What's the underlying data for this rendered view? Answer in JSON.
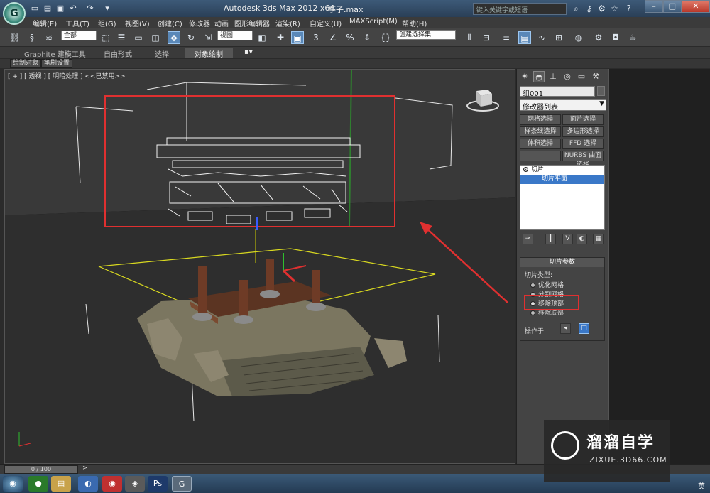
{
  "titlebar": {
    "app_title": "Autodesk 3ds Max  2012 x64",
    "file_title": "亭子.max",
    "search_placeholder": "键入关键字或短语",
    "help_label": "?",
    "logo": "3ds-max-logo"
  },
  "menubar": [
    "编辑(E)",
    "工具(T)",
    "组(G)",
    "视图(V)",
    "创建(C)",
    "修改器",
    "动画",
    "图形编辑器",
    "渲染(R)",
    "自定义(U)",
    "MAXScript(M)",
    "帮助(H)"
  ],
  "toolbar": {
    "filter_value": "全部",
    "refcoord_value": "视图",
    "numeric_a": "3",
    "numeric_b": "%",
    "selset_value": "创建选择集"
  },
  "ribbon": {
    "tabs": [
      "Graphite 建模工具",
      "自由形式",
      "选择",
      "对象绘制"
    ],
    "subtabs": [
      "绘制对象",
      "笔刷设置"
    ]
  },
  "viewport": {
    "label": "[ + ] [ 透视 ] [ 明暗处理 ] <<已禁用>>",
    "annotation_color": "#e03030"
  },
  "cmdpanel": {
    "object_name": "组001",
    "modifier_list": "修改器列表",
    "buttons": [
      "网格选择",
      "面片选择",
      "样条线选择",
      "多边形选择",
      "体积选择",
      "FFD 选择",
      "",
      "NURBS 曲面选择"
    ],
    "stack": [
      "切片",
      "切片平面"
    ],
    "rollout": {
      "title": "切片参数",
      "type_label": "切片类型:",
      "options": [
        "优化网格",
        "分割网格",
        "移除顶部",
        "移除底部"
      ],
      "selected": 2,
      "operate_label": "操作于:"
    }
  },
  "timeline": {
    "frame": "0 / 100"
  },
  "watermark": {
    "title": "溜溜自学",
    "url": "ZIXUE.3D66.COM"
  },
  "taskbar": {
    "lang": "英"
  }
}
